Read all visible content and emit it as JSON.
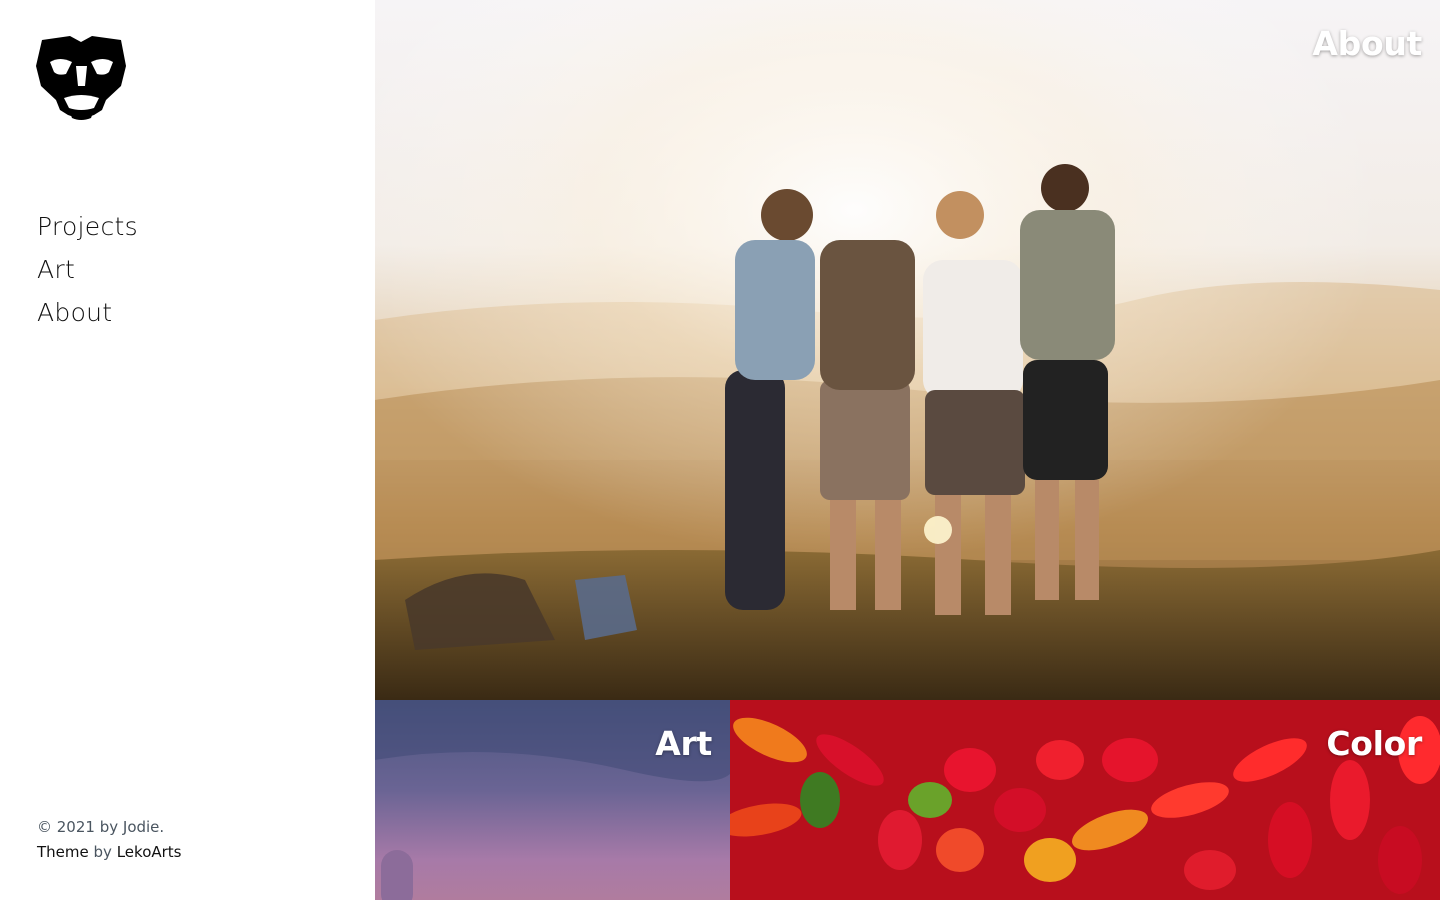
{
  "sidebar": {
    "logo": {
      "icon": "lion-head-icon",
      "label": "Jodie"
    },
    "nav": [
      {
        "label": "Projects"
      },
      {
        "label": "Art"
      },
      {
        "label": "About"
      }
    ],
    "footer": {
      "copyright_prefix": "© 2021 by",
      "author": "Jodie.",
      "theme_label": "Theme",
      "by_label": "by",
      "theme_author": "LekoArts"
    }
  },
  "tiles": [
    {
      "title": "About"
    },
    {
      "title": "Art"
    },
    {
      "title": "Color"
    }
  ],
  "colors": {
    "text_primary": "#111111",
    "text_secondary": "#4a5560",
    "tile_title": "#ffffff"
  }
}
